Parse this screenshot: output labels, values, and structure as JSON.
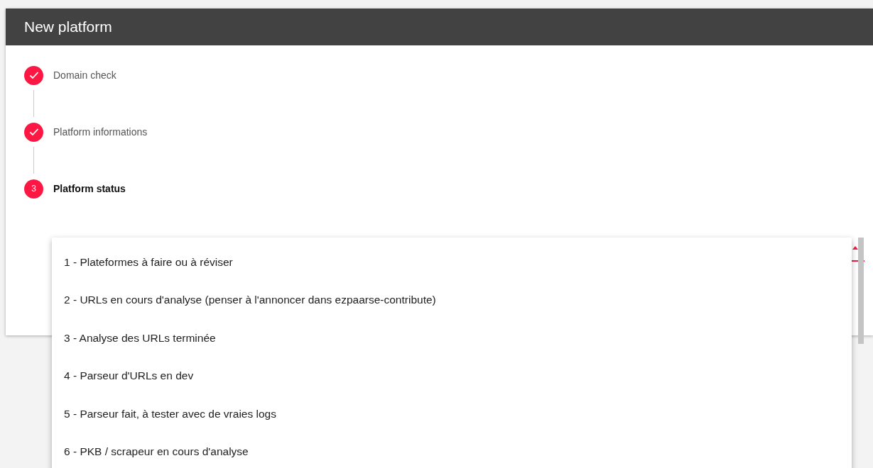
{
  "dialog": {
    "title": "New platform"
  },
  "steps": [
    {
      "label": "Domain check",
      "completed": true,
      "active": false
    },
    {
      "label": "Platform informations",
      "completed": true,
      "active": false
    },
    {
      "label": "Platform status",
      "completed": false,
      "active": true,
      "number": "3"
    }
  ],
  "status_menu": {
    "options": [
      {
        "label": "1 - Plateformes à faire ou à réviser"
      },
      {
        "label": "2 - URLs en cours d'analyse (penser à l'annoncer dans ezpaarse-contribute)"
      },
      {
        "label": "3 - Analyse des URLs terminée"
      },
      {
        "label": "4 - Parseur d'URLs en dev"
      },
      {
        "label": "5 - Parseur fait, à tester avec de vraies logs"
      },
      {
        "label": "6 - PKB / scrapeur en cours d'analyse"
      }
    ]
  }
}
